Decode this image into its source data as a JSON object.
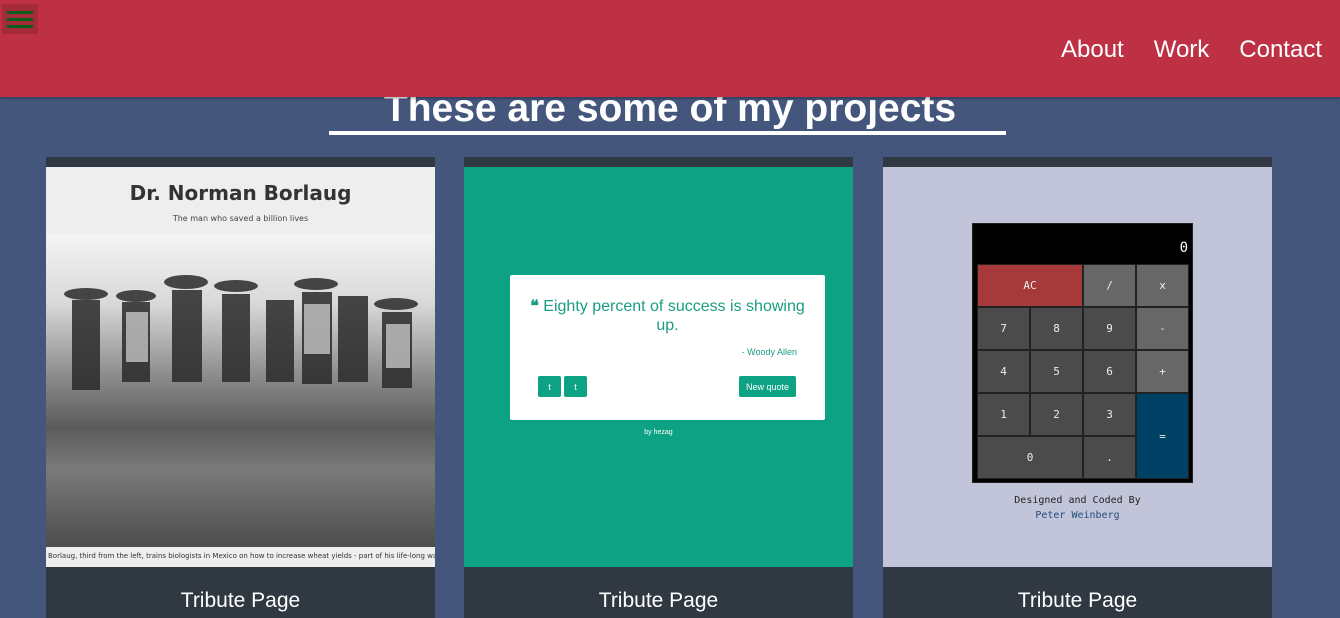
{
  "nav": {
    "links": [
      "About",
      "Work",
      "Contact"
    ]
  },
  "heading": "These are some of my projects",
  "cards": [
    {
      "title": "Tribute Page",
      "thumb": {
        "name": "Dr. Norman Borlaug",
        "subtitle": "The man who saved a billion lives",
        "caption": "Borlaug, third from the left, trains biologists in Mexico on how to increase wheat yields - part of his life-long war"
      }
    },
    {
      "title": "Tribute Page",
      "thumb": {
        "quote": "Eighty percent of success is showing up.",
        "author": "- Woody Allen",
        "new_quote": "New quote",
        "twitter": "t",
        "tumblr": "t",
        "by": "by hezag"
      }
    },
    {
      "title": "Tribute Page",
      "thumb": {
        "display": "0",
        "buttons": {
          "ac": "AC",
          "divide": "/",
          "multiply": "x",
          "seven": "7",
          "eight": "8",
          "nine": "9",
          "minus": "-",
          "four": "4",
          "five": "5",
          "six": "6",
          "plus": "+",
          "one": "1",
          "two": "2",
          "three": "3",
          "equals": "=",
          "zero": "0",
          "decimal": "."
        },
        "credit_line1": "Designed and Coded By",
        "credit_line2": "Peter Weinberg"
      }
    }
  ],
  "colors": {
    "navbar": "#be3144",
    "background": "#45567d",
    "card": "#303841"
  }
}
